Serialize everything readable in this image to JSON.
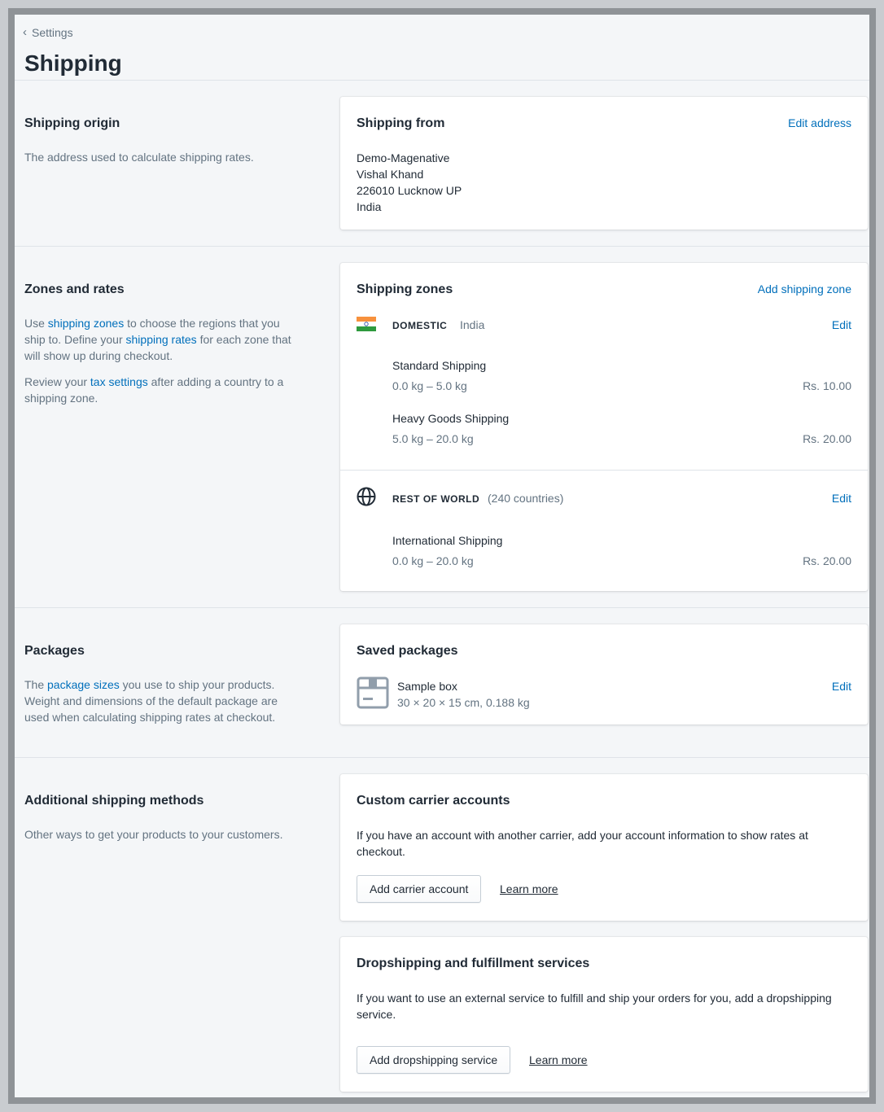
{
  "breadcrumb": {
    "label": "Settings"
  },
  "page": {
    "title": "Shipping"
  },
  "origin": {
    "heading": "Shipping origin",
    "description": "The address used to calculate shipping rates.",
    "card": {
      "title": "Shipping from",
      "action": "Edit address",
      "address_lines": [
        "Demo-Magenative",
        "Vishal Khand",
        "226010 Lucknow UP",
        "India"
      ]
    }
  },
  "zones": {
    "heading": "Zones and rates",
    "desc1": {
      "t1": "Use ",
      "link1": "shipping zones",
      "t2": " to choose the regions that you ship to. Define your ",
      "link2": "shipping rates",
      "t3": " for each zone that will show up during checkout."
    },
    "desc2": {
      "t1": "Review your ",
      "link": "tax settings",
      "t2": " after adding a country to a shipping zone."
    },
    "card": {
      "title": "Shipping zones",
      "action": "Add shipping zone",
      "domestic": {
        "name": "DOMESTIC",
        "detail": "India",
        "edit": "Edit",
        "rates": [
          {
            "name": "Standard Shipping",
            "range": "0.0 kg – 5.0 kg",
            "price": "Rs. 10.00"
          },
          {
            "name": "Heavy Goods Shipping",
            "range": "5.0 kg – 20.0 kg",
            "price": "Rs. 20.00"
          }
        ]
      },
      "world": {
        "name": "REST OF WORLD",
        "detail": "(240 countries)",
        "edit": "Edit",
        "rates": [
          {
            "name": "International Shipping",
            "range": "0.0 kg – 20.0 kg",
            "price": "Rs. 20.00"
          }
        ]
      }
    }
  },
  "packages": {
    "heading": "Packages",
    "desc": {
      "t1": "The ",
      "link": "package sizes",
      "t2": " you use to ship your products. Weight and dimensions of the default package are used when calculating shipping rates at checkout."
    },
    "card": {
      "title": "Saved packages",
      "item_name": "Sample box",
      "item_detail": "30 × 20 × 15 cm, 0.188 kg",
      "edit": "Edit"
    }
  },
  "additional": {
    "heading": "Additional shipping methods",
    "description": "Other ways to get your products to your customers.",
    "carrier": {
      "title": "Custom carrier accounts",
      "text": "If you have an account with another carrier, add your account information to show rates at checkout.",
      "button": "Add carrier account",
      "learn": "Learn more"
    },
    "dropship": {
      "title": "Dropshipping and fulfillment services",
      "text": "If you want to use an external service to fulfill and ship your orders for you, add a dropshipping service.",
      "button": "Add dropshipping service",
      "learn": "Learn more"
    }
  },
  "colors": {
    "link": "#006fbb",
    "text": "#212b36",
    "muted": "#637381",
    "background": "#f4f6f8"
  }
}
